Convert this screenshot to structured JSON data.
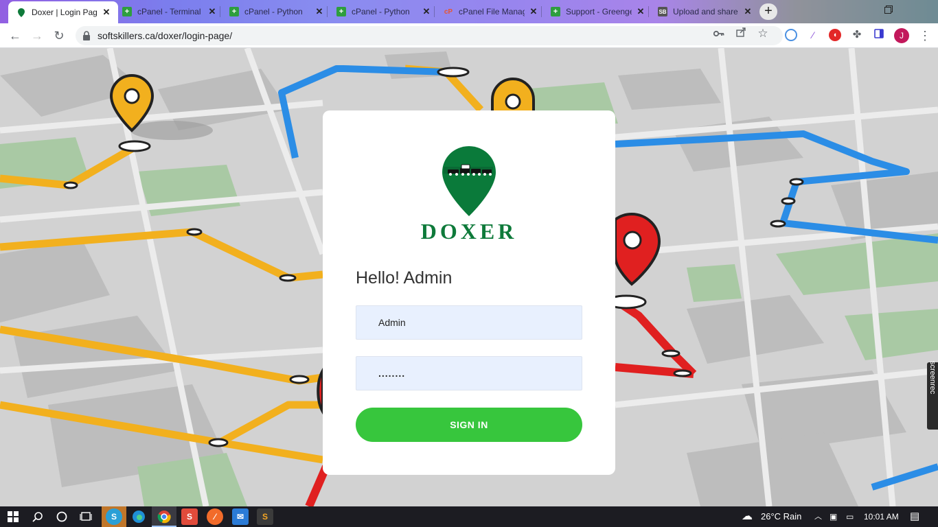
{
  "browser": {
    "tabs": [
      {
        "title": "Doxer | Login Page",
        "favicon": "map-pin-icon",
        "active": true
      },
      {
        "title": "cPanel - Terminal",
        "favicon": "plus-icon",
        "active": false
      },
      {
        "title": "cPanel - Python",
        "favicon": "plus-icon",
        "active": false
      },
      {
        "title": "cPanel - Python",
        "favicon": "plus-icon",
        "active": false
      },
      {
        "title": "cPanel File Manager",
        "favicon": "cpanel-icon",
        "active": false
      },
      {
        "title": "Support - Greengeeks",
        "favicon": "plus-icon",
        "active": false
      },
      {
        "title": "Upload and share",
        "favicon": "sb-icon",
        "active": false
      }
    ],
    "close_glyph": "✕",
    "new_tab_glyph": "+",
    "url": "softskillers.ca/doxer/login-page/",
    "profile_initial": "J",
    "cpanel_favicon_text": "cP",
    "sb_favicon_text": "SB"
  },
  "login": {
    "brand": "DOXER",
    "greeting": "Hello! Admin",
    "username_value": "Admin",
    "password_value": "........",
    "signin_label": "SIGN IN"
  },
  "overlay": {
    "screenrec_label": "screenrec"
  },
  "taskbar": {
    "weather": "26°C  Rain",
    "time": "10:01 AM"
  },
  "colors": {
    "brand_green": "#0e7a3a",
    "button_green": "#37c63d",
    "input_bg": "#e8f0fe",
    "route_yellow": "#f2b01e",
    "route_blue": "#2b8de6",
    "route_red": "#e02020"
  }
}
